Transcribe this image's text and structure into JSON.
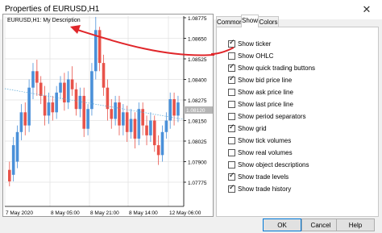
{
  "window": {
    "title": "Properties of EURUSD,H1",
    "close_glyph": "✕"
  },
  "chart": {
    "symbol_label": "EURUSD,H1:  My Description",
    "price_ticks": [
      "1.08775",
      "1.08650",
      "1.08525",
      "1.08400",
      "1.08275",
      "1.08150",
      "1.08025",
      "1.07900",
      "1.07775"
    ],
    "current_price_badge": "1.08120",
    "time_ticks": [
      "7 May 2020",
      "8 May 05:00",
      "8 May 21:00",
      "8 May 14:00",
      "12 May 06:00"
    ],
    "colors": {
      "up": "#4a90d9",
      "down": "#e8534a",
      "grid": "#e3e3e3",
      "bid_line": "#5aa9d6",
      "arrow": "#e0262a"
    }
  },
  "tabs": [
    {
      "label": "Common"
    },
    {
      "label": "Show"
    },
    {
      "label": "Colors"
    }
  ],
  "options": [
    {
      "label": "Show ticker",
      "checked": true
    },
    {
      "label": "Show OHLC",
      "checked": false
    },
    {
      "label": "Show quick trading buttons",
      "checked": true
    },
    {
      "label": "Show bid price line",
      "checked": true
    },
    {
      "label": "Show ask price line",
      "checked": false
    },
    {
      "label": "Show last price line",
      "checked": false
    },
    {
      "label": "Show period separators",
      "checked": false
    },
    {
      "label": "Show grid",
      "checked": true
    },
    {
      "label": "Show tick volumes",
      "checked": false
    },
    {
      "label": "Show real volumes",
      "checked": false
    },
    {
      "label": "Show object descriptions",
      "checked": false
    },
    {
      "label": "Show trade levels",
      "checked": true
    },
    {
      "label": "Show trade history",
      "checked": true
    }
  ],
  "buttons": {
    "ok": "OK",
    "cancel": "Cancel",
    "help": "Help"
  }
}
